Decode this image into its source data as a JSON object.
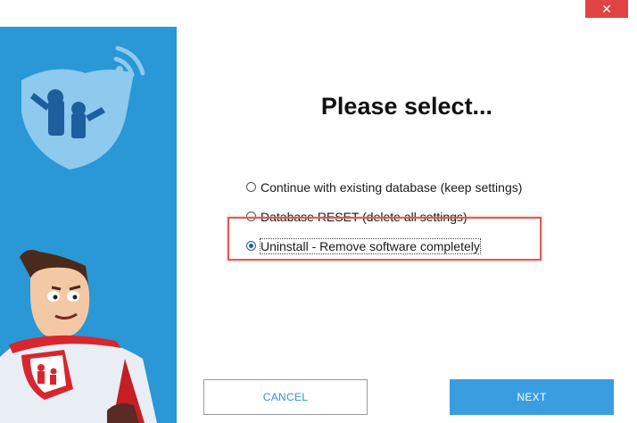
{
  "window": {
    "close_glyph": "✕",
    "accent_color": "#2a97d6",
    "close_color": "#e04343"
  },
  "title": "Please select...",
  "options": [
    {
      "label": "Continue with existing database (keep settings)",
      "selected": false
    },
    {
      "label": "Database RESET (delete all settings)",
      "selected": false
    },
    {
      "label": "Uninstall - Remove software completely",
      "selected": true
    }
  ],
  "buttons": {
    "cancel": "CANCEL",
    "next": "NEXT"
  },
  "side_panel": {
    "logo_icon": "family-shield-icon",
    "mascot_icon": "superhero-mascot-icon"
  }
}
